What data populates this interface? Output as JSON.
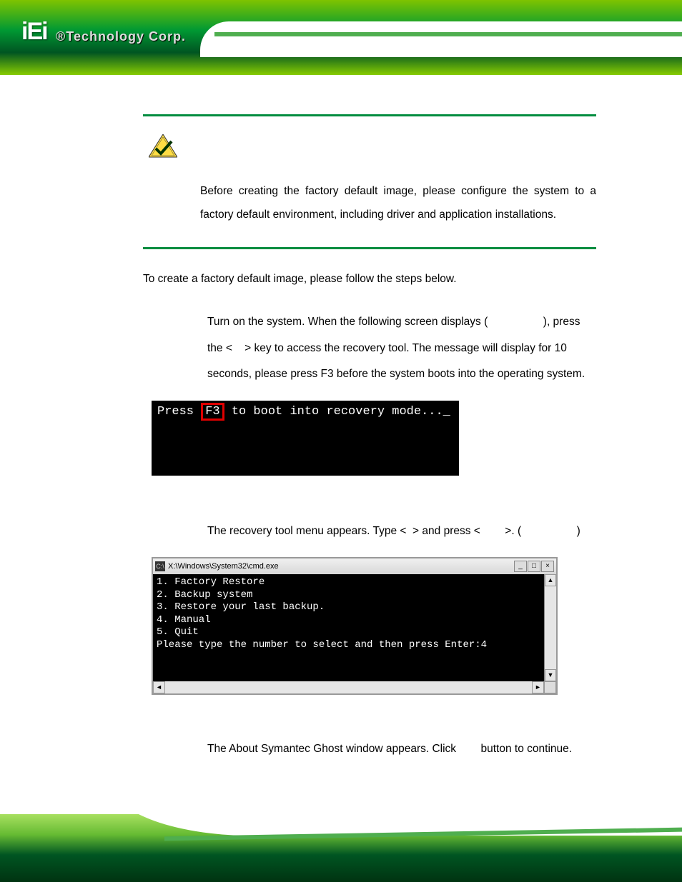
{
  "logo": {
    "mark": "iEi",
    "text": "®Technology Corp."
  },
  "note": {
    "body": "Before creating the factory default image, please configure the system to a factory default environment, including driver and application installations."
  },
  "intro": "To create a factory default image, please follow the steps below.",
  "step1": "Turn on the system. When the following screen displays (                  ), press the <    > key to access the recovery tool. The message will display for 10 seconds, please press F3 before the system boots into the operating system.",
  "boot_screen": {
    "prefix": "Press ",
    "key": "F3",
    "suffix": " to boot into recovery mode..._"
  },
  "step2": "The recovery tool menu appears. Type <  > and press <        >. (                  )",
  "cmd": {
    "title_icon": "C:\\",
    "title": "X:\\Windows\\System32\\cmd.exe",
    "lines": "1. Factory Restore\n2. Backup system\n3. Restore your last backup.\n4. Manual\n5. Quit\nPlease type the number to select and then press Enter:4",
    "btn_min": "_",
    "btn_max": "□",
    "btn_close": "×",
    "arrow_up": "▲",
    "arrow_down": "▼",
    "arrow_left": "◄",
    "arrow_right": "►"
  },
  "step3": "The About Symantec Ghost window appears. Click        button to continue."
}
